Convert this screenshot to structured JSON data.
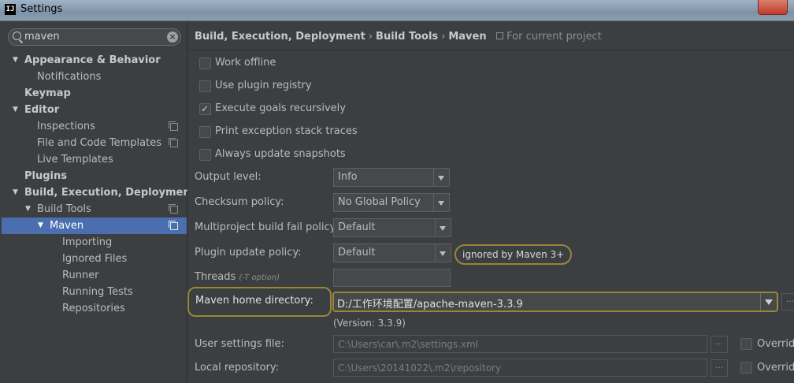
{
  "window": {
    "title": "Settings",
    "app_icon": "IJ"
  },
  "search": {
    "value": "maven"
  },
  "tree": [
    {
      "label": "Appearance & Behavior",
      "level": 0,
      "bold": true,
      "expanded": true,
      "name": "tree-appearance-behavior"
    },
    {
      "label": "Notifications",
      "level": 1,
      "name": "tree-notifications"
    },
    {
      "label": "Keymap",
      "level": 0,
      "bold": true,
      "name": "tree-keymap"
    },
    {
      "label": "Editor",
      "level": 0,
      "bold": true,
      "expanded": true,
      "name": "tree-editor"
    },
    {
      "label": "Inspections",
      "level": 1,
      "project": true,
      "name": "tree-inspections"
    },
    {
      "label": "File and Code Templates",
      "level": 1,
      "project": true,
      "name": "tree-file-code-templates"
    },
    {
      "label": "Live Templates",
      "level": 1,
      "name": "tree-live-templates"
    },
    {
      "label": "Plugins",
      "level": 0,
      "bold": true,
      "name": "tree-plugins"
    },
    {
      "label": "Build, Execution, Deployment",
      "level": 0,
      "bold": true,
      "expanded": true,
      "name": "tree-build-execution-deployment"
    },
    {
      "label": "Build Tools",
      "level": 1,
      "expanded": true,
      "project": true,
      "name": "tree-build-tools"
    },
    {
      "label": "Maven",
      "level": 2,
      "expanded": true,
      "project": true,
      "selected": true,
      "name": "tree-maven"
    },
    {
      "label": "Importing",
      "level": 3,
      "name": "tree-importing"
    },
    {
      "label": "Ignored Files",
      "level": 3,
      "name": "tree-ignored-files"
    },
    {
      "label": "Runner",
      "level": 3,
      "name": "tree-runner"
    },
    {
      "label": "Running Tests",
      "level": 3,
      "name": "tree-running-tests"
    },
    {
      "label": "Repositories",
      "level": 3,
      "name": "tree-repositories"
    }
  ],
  "breadcrumb": {
    "parts": [
      "Build, Execution, Deployment",
      "Build Tools",
      "Maven"
    ],
    "separator": "›",
    "scope": "For current project"
  },
  "checkboxes": [
    {
      "label": "Work offline",
      "checked": false
    },
    {
      "label": "Use plugin registry",
      "checked": false
    },
    {
      "label": "Execute goals recursively",
      "checked": true
    },
    {
      "label": "Print exception stack traces",
      "checked": false
    },
    {
      "label": "Always update snapshots",
      "checked": false
    }
  ],
  "fields": {
    "output_level": {
      "label": "Output level:",
      "value": "Info"
    },
    "checksum_policy": {
      "label": "Checksum policy:",
      "value": "No Global Policy"
    },
    "multiproject_fail_policy": {
      "label": "Multiproject build fail policy:",
      "value": "Default"
    },
    "plugin_update_policy": {
      "label": "Plugin update policy:",
      "value": "Default",
      "note": "ignored by Maven 3+"
    },
    "threads": {
      "label": "Threads",
      "hint": "(-T option)",
      "value": ""
    },
    "maven_home": {
      "label": "Maven home directory:",
      "value": "D:/工作环境配置/apache-maven-3.3.9",
      "version": "(Version: 3.3.9)"
    },
    "user_settings": {
      "label": "User settings file:",
      "value": "C:\\Users\\car\\.m2\\settings.xml",
      "override": "Override"
    },
    "local_repository": {
      "label": "Local repository:",
      "value": "C:\\Users\\20141022\\.m2\\repository",
      "override": "Override"
    },
    "browse_label": "..."
  },
  "colors": {
    "accent_selection": "#4b6eaf",
    "highlight_outline": "#9b8538",
    "background": "#3c3f41"
  }
}
